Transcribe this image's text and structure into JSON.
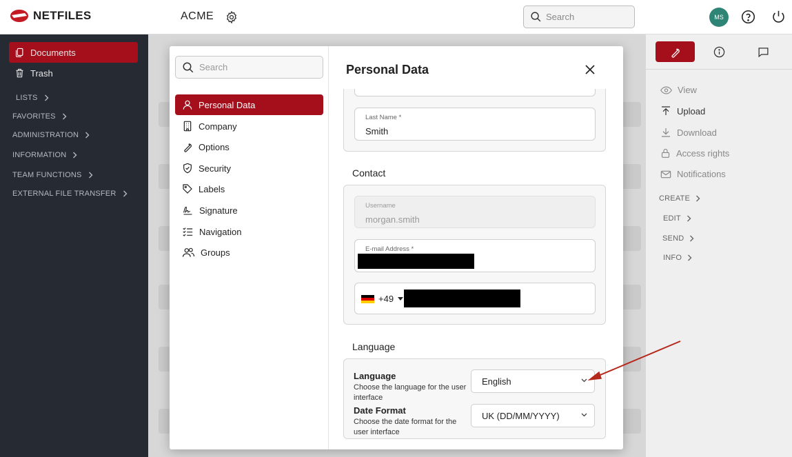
{
  "topbar": {
    "logo_text": "NETFILES",
    "org_name": "ACME",
    "search_placeholder": "Search",
    "avatar_initials": "MS"
  },
  "sidebar": {
    "items": [
      {
        "label": "Documents",
        "icon": "documents-icon",
        "active": true
      },
      {
        "label": "Trash",
        "icon": "trash-icon",
        "active": false
      }
    ],
    "sections": [
      "LISTS",
      "FAVORITES",
      "ADMINISTRATION",
      "INFORMATION",
      "TEAM FUNCTIONS",
      "EXTERNAL FILE TRANSFER"
    ]
  },
  "right_panel": {
    "tabs": [
      "wrench-icon",
      "info-icon",
      "comment-icon"
    ],
    "actions": [
      {
        "label": "View",
        "icon": "eye-icon",
        "enabled": false
      },
      {
        "label": "Upload",
        "icon": "upload-icon",
        "enabled": true
      },
      {
        "label": "Download",
        "icon": "download-icon",
        "enabled": false
      },
      {
        "label": "Access rights",
        "icon": "lock-icon",
        "enabled": false
      },
      {
        "label": "Notifications",
        "icon": "mail-icon",
        "enabled": false
      }
    ],
    "sections": [
      "CREATE",
      "EDIT",
      "SEND",
      "INFO"
    ]
  },
  "modal": {
    "search_placeholder": "Search",
    "title": "Personal Data",
    "nav": [
      {
        "label": "Personal Data",
        "icon": "user-icon",
        "active": true
      },
      {
        "label": "Company",
        "icon": "building-icon",
        "active": false
      },
      {
        "label": "Options",
        "icon": "wrench-icon",
        "active": false
      },
      {
        "label": "Security",
        "icon": "shield-icon",
        "active": false
      },
      {
        "label": "Labels",
        "icon": "tag-icon",
        "active": false
      },
      {
        "label": "Signature",
        "icon": "signature-icon",
        "active": false
      },
      {
        "label": "Navigation",
        "icon": "checklist-icon",
        "active": false
      },
      {
        "label": "Groups",
        "icon": "users-icon",
        "active": false
      }
    ],
    "personal": {
      "last_name_label": "Last Name *",
      "last_name_value": "Smith"
    },
    "contact": {
      "heading": "Contact",
      "username_label": "Username",
      "username_value": "morgan.smith",
      "email_label": "E-mail Address *",
      "phone_prefix": "+49"
    },
    "language": {
      "heading": "Language",
      "language_label": "Language",
      "language_desc": "Choose the language for the user interface",
      "language_value": "English",
      "date_label": "Date Format",
      "date_desc": "Choose the date format for the user interface",
      "date_value": "UK (DD/MM/YYYY)"
    }
  },
  "colors": {
    "accent": "#a50f1c",
    "sidebar_bg": "#252a33",
    "avatar_bg": "#2e8576",
    "annotation_arrow": "#b5281c"
  }
}
